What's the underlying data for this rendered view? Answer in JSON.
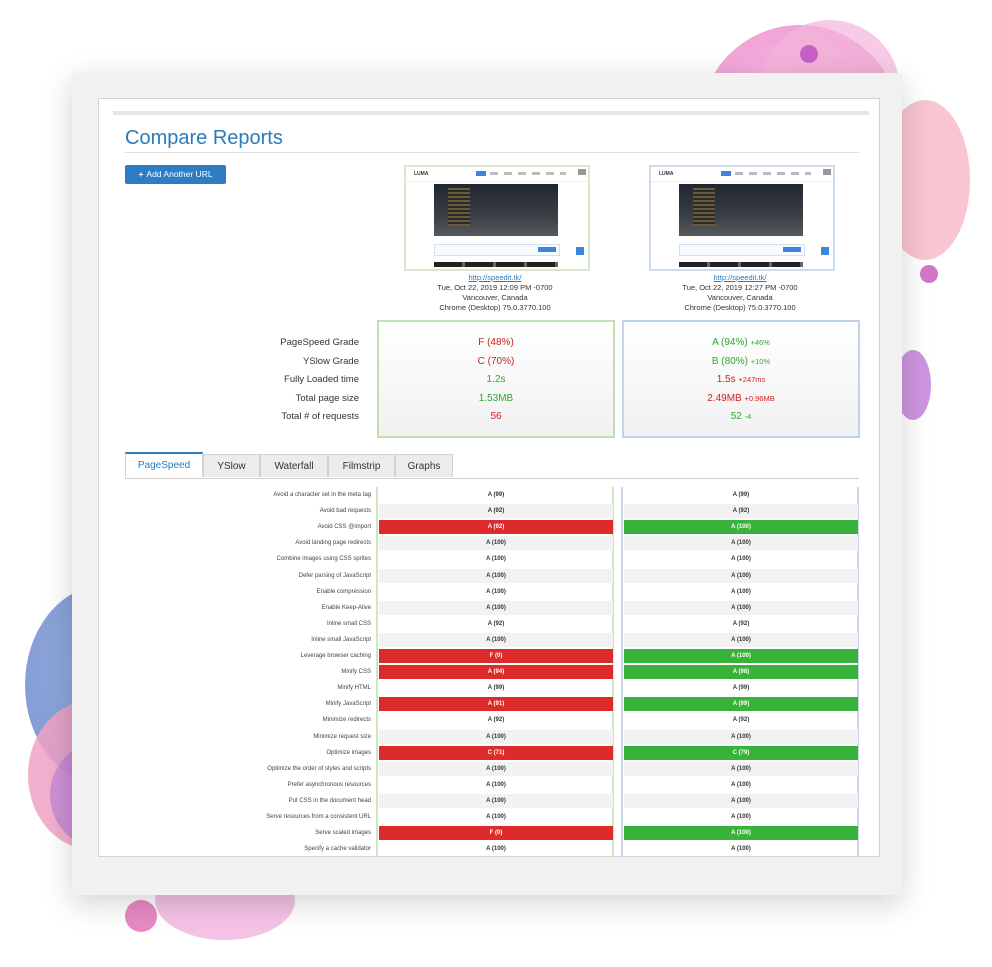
{
  "page": {
    "title": "Compare Reports",
    "add_button": "Add Another URL",
    "colors": {
      "accent": "#2b7bb9",
      "bad": "#dd2b2b",
      "good": "#38b238"
    }
  },
  "reports": [
    {
      "thumb_logo": "LUMA",
      "url": "http://speedit.tk/",
      "date": "Tue, Oct 22, 2019 12:09 PM -0700",
      "location": "Vancouver, Canada",
      "browser": "Chrome (Desktop) 75.0.3770.100"
    },
    {
      "thumb_logo": "LUMA",
      "url": "http://speedit.tk/",
      "date": "Tue, Oct 22, 2019 12:27 PM -0700",
      "location": "Vancouver, Canada",
      "browser": "Chrome (Desktop) 75.0.3770.100"
    }
  ],
  "summary": {
    "labels": [
      "PageSpeed Grade",
      "YSlow Grade",
      "Fully Loaded time",
      "Total page size",
      "Total # of requests"
    ],
    "a": [
      {
        "value": "F (48%)",
        "tone": "red"
      },
      {
        "value": "C (70%)",
        "tone": "red"
      },
      {
        "value": "1.2s",
        "tone": "green"
      },
      {
        "value": "1.53MB",
        "tone": "green"
      },
      {
        "value": "56",
        "tone": "red"
      }
    ],
    "b": [
      {
        "value": "A (94%)",
        "delta": "+46%",
        "tone": "green"
      },
      {
        "value": "B (80%)",
        "delta": "+10%",
        "tone": "green"
      },
      {
        "value": "1.5s",
        "delta": "+247ms",
        "tone": "red"
      },
      {
        "value": "2.49MB",
        "delta": "+0.96MB",
        "tone": "red"
      },
      {
        "value": "52",
        "delta": "-4",
        "tone": "green"
      }
    ]
  },
  "tabs": [
    "PageSpeed",
    "YSlow",
    "Waterfall",
    "Filmstrip",
    "Graphs"
  ],
  "active_tab": "PageSpeed",
  "rules": [
    {
      "name": "Avoid a character set in the meta tag",
      "a": "A (99)",
      "b": "A (99)"
    },
    {
      "name": "Avoid bad requests",
      "a": "A (92)",
      "b": "A (92)"
    },
    {
      "name": "Avoid CSS @import",
      "a": "A (92)",
      "b": "A (100)",
      "a_state": "bad",
      "b_state": "good"
    },
    {
      "name": "Avoid landing page redirects",
      "a": "A (100)",
      "b": "A (100)"
    },
    {
      "name": "Combine images using CSS sprites",
      "a": "A (100)",
      "b": "A (100)"
    },
    {
      "name": "Defer parsing of JavaScript",
      "a": "A (100)",
      "b": "A (100)"
    },
    {
      "name": "Enable compression",
      "a": "A (100)",
      "b": "A (100)"
    },
    {
      "name": "Enable Keep-Alive",
      "a": "A (100)",
      "b": "A (100)"
    },
    {
      "name": "Inline small CSS",
      "a": "A (92)",
      "b": "A (92)"
    },
    {
      "name": "Inline small JavaScript",
      "a": "A (100)",
      "b": "A (100)"
    },
    {
      "name": "Leverage browser caching",
      "a": "F (0)",
      "b": "A (100)",
      "a_state": "bad",
      "b_state": "good"
    },
    {
      "name": "Minify CSS",
      "a": "A (94)",
      "b": "A (98)",
      "a_state": "bad",
      "b_state": "good"
    },
    {
      "name": "Minify HTML",
      "a": "A (99)",
      "b": "A (99)"
    },
    {
      "name": "Minify JavaScript",
      "a": "A (91)",
      "b": "A (99)",
      "a_state": "bad",
      "b_state": "good"
    },
    {
      "name": "Minimize redirects",
      "a": "A (92)",
      "b": "A (92)"
    },
    {
      "name": "Minimize request size",
      "a": "A (100)",
      "b": "A (100)"
    },
    {
      "name": "Optimize images",
      "a": "C (71)",
      "b": "C (79)",
      "a_state": "bad",
      "b_state": "good"
    },
    {
      "name": "Optimize the order of styles and scripts",
      "a": "A (100)",
      "b": "A (100)"
    },
    {
      "name": "Prefer asynchronous resources",
      "a": "A (100)",
      "b": "A (100)"
    },
    {
      "name": "Put CSS in the document head",
      "a": "A (100)",
      "b": "A (100)"
    },
    {
      "name": "Serve resources from a consistent URL",
      "a": "A (100)",
      "b": "A (100)"
    },
    {
      "name": "Serve scaled images",
      "a": "F (0)",
      "b": "A (100)",
      "a_state": "bad",
      "b_state": "good"
    },
    {
      "name": "Specify a cache validator",
      "a": "A (100)",
      "b": "A (100)"
    }
  ]
}
